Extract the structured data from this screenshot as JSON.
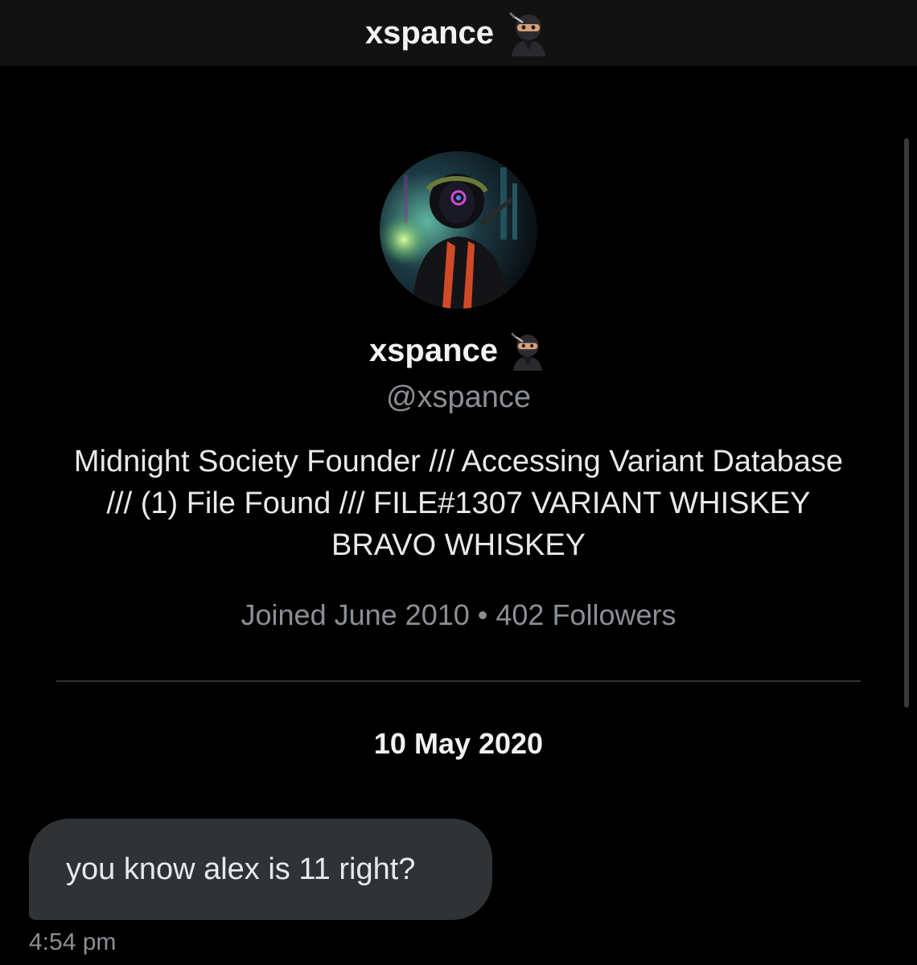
{
  "header": {
    "title": "xspance",
    "icon": "ninja-emoji-icon"
  },
  "profile": {
    "avatar_icon": "profile-avatar",
    "display_name": "xspance",
    "handle": "@xspance",
    "bio": "Midnight Society Founder /// Accessing Variant Database /// (1) File Found /// FILE#1307 VARIANT WHISKEY BRAVO WHISKEY",
    "joined": "Joined June 2010",
    "separator": "•",
    "followers": "402 Followers"
  },
  "conversation": {
    "date": "10 May 2020",
    "messages": [
      {
        "text": "you know alex is 11 right?",
        "time": "4:54 pm"
      }
    ]
  },
  "colors": {
    "background": "#000000",
    "header_bg": "#121212",
    "bubble_bg": "#2f3336",
    "muted_text": "#8b8f94"
  }
}
